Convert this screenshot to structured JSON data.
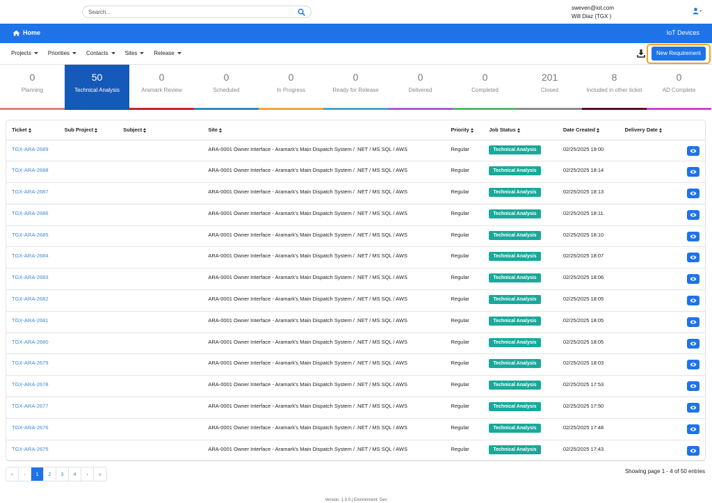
{
  "search": {
    "placeholder": "Search..."
  },
  "user": {
    "email": "sweven@iot.com",
    "name": "Will Diaz (TGX )"
  },
  "header": {
    "home_label": "Home",
    "app_title": "IoT Devices"
  },
  "nav": [
    "Projects",
    "Priorities",
    "Contacts",
    "Sites",
    "Release"
  ],
  "toolbar": {
    "new_requirement_label": "New Requirement"
  },
  "tiles": [
    {
      "count": "0",
      "label": "Planning",
      "color": "#e27d7d"
    },
    {
      "count": "50",
      "label": "Technical Analysis",
      "color": "#1559b9"
    },
    {
      "count": "0",
      "label": "Aramark Review",
      "color": "#cc1f2a"
    },
    {
      "count": "0",
      "label": "Scheduled",
      "color": "#2f8ac6"
    },
    {
      "count": "0",
      "label": "In Progress",
      "color": "#f2a43a"
    },
    {
      "count": "0",
      "label": "Ready for Release",
      "color": "#49a6c6"
    },
    {
      "count": "0",
      "label": "Delivered",
      "color": "#a75cd6"
    },
    {
      "count": "0",
      "label": "Completed",
      "color": "#57b86a"
    },
    {
      "count": "201",
      "label": "Closed",
      "color": "#8a8a8a"
    },
    {
      "count": "8",
      "label": "Included in other ticket",
      "color": "#5a1020"
    },
    {
      "count": "0",
      "label": "AD Complete",
      "color": "#d43fd6"
    }
  ],
  "table": {
    "headers": [
      "Ticket",
      "Sub Project",
      "Subject",
      "Site",
      "Priority",
      "Job Status",
      "Date Created",
      "Delivery Date"
    ],
    "rows": [
      {
        "ticket": "TGX-ARA-2689",
        "site": "ARA-0001 Owner Interface - Aramark's Main Dispatch System / .NET / MS SQL / AWS",
        "priority": "Regular",
        "status": "Technical Analysis",
        "created": "02/25/2025 19:00"
      },
      {
        "ticket": "TGX-ARA-2688",
        "site": "ARA-0001 Owner Interface - Aramark's Main Dispatch System / .NET / MS SQL / AWS",
        "priority": "Regular",
        "status": "Technical Analysis",
        "created": "02/25/2025 18:14"
      },
      {
        "ticket": "TGX-ARA-2687",
        "site": "ARA-0001 Owner Interface - Aramark's Main Dispatch System / .NET / MS SQL / AWS",
        "priority": "Regular",
        "status": "Technical Analysis",
        "created": "02/25/2025 18:13"
      },
      {
        "ticket": "TGX-ARA-2686",
        "site": "ARA-0001 Owner Interface - Aramark's Main Dispatch System / .NET / MS SQL / AWS",
        "priority": "Regular",
        "status": "Technical Analysis",
        "created": "02/25/2025 18:11"
      },
      {
        "ticket": "TGX-ARA-2685",
        "site": "ARA-0001 Owner Interface - Aramark's Main Dispatch System / .NET / MS SQL / AWS",
        "priority": "Regular",
        "status": "Technical Analysis",
        "created": "02/25/2025 18:10"
      },
      {
        "ticket": "TGX-ARA-2684",
        "site": "ARA-0001 Owner Interface - Aramark's Main Dispatch System / .NET / MS SQL / AWS",
        "priority": "Regular",
        "status": "Technical Analysis",
        "created": "02/25/2025 18:07"
      },
      {
        "ticket": "TGX-ARA-2683",
        "site": "ARA-0001 Owner Interface - Aramark's Main Dispatch System / .NET / MS SQL / AWS",
        "priority": "Regular",
        "status": "Technical Analysis",
        "created": "02/25/2025 18:06"
      },
      {
        "ticket": "TGX-ARA-2682",
        "site": "ARA-0001 Owner Interface - Aramark's Main Dispatch System / .NET / MS SQL / AWS",
        "priority": "Regular",
        "status": "Technical Analysis",
        "created": "02/25/2025 18:05"
      },
      {
        "ticket": "TGX-ARA-2681",
        "site": "ARA-0001 Owner Interface - Aramark's Main Dispatch System / .NET / MS SQL / AWS",
        "priority": "Regular",
        "status": "Technical Analysis",
        "created": "02/25/2025 18:05"
      },
      {
        "ticket": "TGX-ARA-2680",
        "site": "ARA-0001 Owner Interface - Aramark's Main Dispatch System / .NET / MS SQL / AWS",
        "priority": "Regular",
        "status": "Technical Analysis",
        "created": "02/25/2025 18:05"
      },
      {
        "ticket": "TGX-ARA-2679",
        "site": "ARA-0001 Owner Interface - Aramark's Main Dispatch System / .NET / MS SQL / AWS",
        "priority": "Regular",
        "status": "Technical Analysis",
        "created": "02/25/2025 18:03"
      },
      {
        "ticket": "TGX-ARA-2678",
        "site": "ARA-0001 Owner Interface - Aramark's Main Dispatch System / .NET / MS SQL / AWS",
        "priority": "Regular",
        "status": "Technical Analysis",
        "created": "02/25/2025 17:53"
      },
      {
        "ticket": "TGX-ARA-2677",
        "site": "ARA-0001 Owner Interface - Aramark's Main Dispatch System / .NET / MS SQL / AWS",
        "priority": "Regular",
        "status": "Technical Analysis",
        "created": "02/25/2025 17:50"
      },
      {
        "ticket": "TGX-ARA-2676",
        "site": "ARA-0001 Owner Interface - Aramark's Main Dispatch System / .NET / MS SQL / AWS",
        "priority": "Regular",
        "status": "Technical Analysis",
        "created": "02/25/2025 17:48"
      },
      {
        "ticket": "TGX-ARA-2675",
        "site": "ARA-0001 Owner Interface - Aramark's Main Dispatch System / .NET / MS SQL / AWS",
        "priority": "Regular",
        "status": "Technical Analysis",
        "created": "02/25/2025 17:43"
      }
    ]
  },
  "pagination": {
    "first": "«",
    "prev": "‹",
    "pages": [
      "1",
      "2",
      "3",
      "4"
    ],
    "next": "›",
    "last": "»",
    "current": "1",
    "summary": "Showing page 1 - 4 of 50 entries"
  },
  "footer": "Version: 1.0.0 | Environment: Dev",
  "colors": {
    "brand_blue": "#1e73e8",
    "highlight_orange": "#f4a11f",
    "status_teal": "#1aa89a"
  },
  "icons": {
    "search": "search-icon",
    "user": "user-icon",
    "home": "home-icon",
    "download": "download-icon",
    "view": "eye-icon"
  }
}
